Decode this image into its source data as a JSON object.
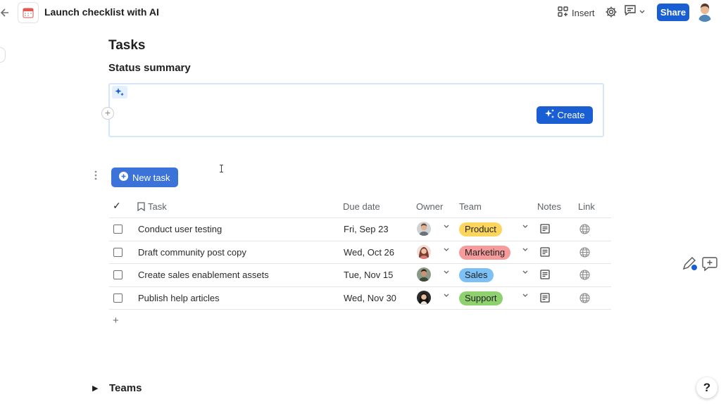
{
  "header": {
    "title": "Launch checklist with AI",
    "insert_label": "Insert",
    "share_label": "Share"
  },
  "page": {
    "heading": "Tasks",
    "section_heading": "Status summary"
  },
  "ai_block": {
    "create_label": "Create"
  },
  "table": {
    "new_task_label": "New task",
    "columns": {
      "check": "✓",
      "task": "Task",
      "due": "Due date",
      "owner": "Owner",
      "team": "Team",
      "notes": "Notes",
      "link": "Link"
    },
    "rows": [
      {
        "task": "Conduct user testing",
        "due": "Fri, Sep 23",
        "team": "Product",
        "team_color": "#fbd55c"
      },
      {
        "task": "Draft community post copy",
        "due": "Wed, Oct 26",
        "team": "Marketing",
        "team_color": "#f59b9b"
      },
      {
        "task": "Create sales enablement assets",
        "due": "Tue, Nov 15",
        "team": "Sales",
        "team_color": "#7cc0f5"
      },
      {
        "task": "Publish help articles",
        "due": "Wed, Nov 30",
        "team": "Support",
        "team_color": "#8fd06f"
      }
    ],
    "add_row_label": "+"
  },
  "teams_section": {
    "toggle": "▶",
    "heading": "Teams"
  },
  "help_label": "?",
  "colors": {
    "primary": "#1a5ed3",
    "new_task": "#3b73d9",
    "ai_border": "#d6e6fa"
  },
  "icons": [
    "back-arrow-icon",
    "calendar-icon",
    "insert-grid-icon",
    "gear-icon",
    "comment-icon",
    "chevron-down-icon",
    "sparkle-icon",
    "plus-icon",
    "bookmark-icon",
    "notes-icon",
    "globe-icon",
    "pen-icon",
    "add-comment-icon",
    "help-icon"
  ]
}
